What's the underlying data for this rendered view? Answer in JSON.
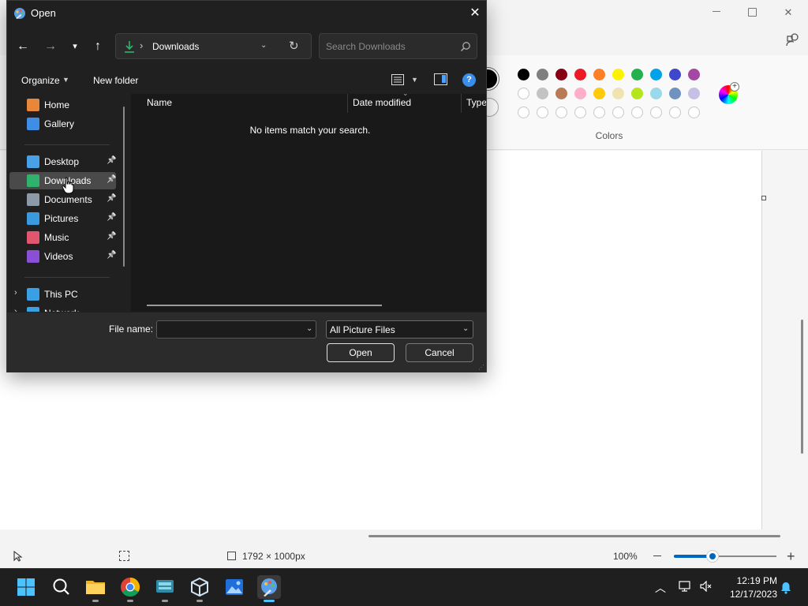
{
  "paint": {
    "colors_label": "Colors",
    "status": {
      "canvas_size": "1792 × 1000px",
      "zoom": "100%",
      "zoom_fraction": 0.38
    },
    "swatches_row1": [
      "#000000",
      "#7f7f7f",
      "#880015",
      "#ed1c24",
      "#ff7f27",
      "#fff200",
      "#22b14c",
      "#00a2e8",
      "#3f48cc",
      "#a349a4"
    ],
    "swatches_row2": [
      "#ffffff",
      "#c3c3c3",
      "#b97a57",
      "#ffaec9",
      "#ffc90e",
      "#efe4b0",
      "#b5e61d",
      "#99d9ea",
      "#7092be",
      "#c8bfe7"
    ],
    "swatches_row3_empty": 10
  },
  "dialog": {
    "title": "Open",
    "address": "Downloads",
    "search_placeholder": "Search Downloads",
    "organize": "Organize",
    "new_folder": "New folder",
    "help": "?",
    "nav_items": [
      {
        "label": "Home",
        "icon": "home-icon",
        "color": "#e8873a"
      },
      {
        "label": "Gallery",
        "icon": "gallery-icon",
        "color": "#3e8ee6"
      },
      {
        "label": "Desktop",
        "icon": "desktop-icon",
        "color": "#4aa0e6",
        "pinned": true
      },
      {
        "label": "Downloads",
        "icon": "downloads-icon",
        "color": "#2fb36c",
        "pinned": true,
        "selected": true
      },
      {
        "label": "Documents",
        "icon": "documents-icon",
        "color": "#8c9aa8",
        "pinned": true
      },
      {
        "label": "Pictures",
        "icon": "pictures-icon",
        "color": "#3a9ae0",
        "pinned": true
      },
      {
        "label": "Music",
        "icon": "music-icon",
        "color": "#e0566e",
        "pinned": true
      },
      {
        "label": "Videos",
        "icon": "videos-icon",
        "color": "#8a4fd6",
        "pinned": true
      },
      {
        "label": "This PC",
        "icon": "this-pc-icon",
        "color": "#39a0e6",
        "expandable": true
      },
      {
        "label": "Network",
        "icon": "network-icon",
        "color": "#39a0e6",
        "expandable": true
      }
    ],
    "columns": [
      "Name",
      "Date modified",
      "Type"
    ],
    "empty_message": "No items match your search.",
    "file_name_label": "File name:",
    "file_name_value": "",
    "file_type": "All Picture Files",
    "open_button": "Open",
    "cancel_button": "Cancel"
  },
  "taskbar": {
    "apps": [
      "start-icon",
      "search-icon",
      "file-explorer-icon",
      "chrome-icon",
      "keyboard-app-icon",
      "virtualbox-icon",
      "photos-icon",
      "paint-icon"
    ],
    "time": "12:19 PM",
    "date": "12/17/2023"
  }
}
